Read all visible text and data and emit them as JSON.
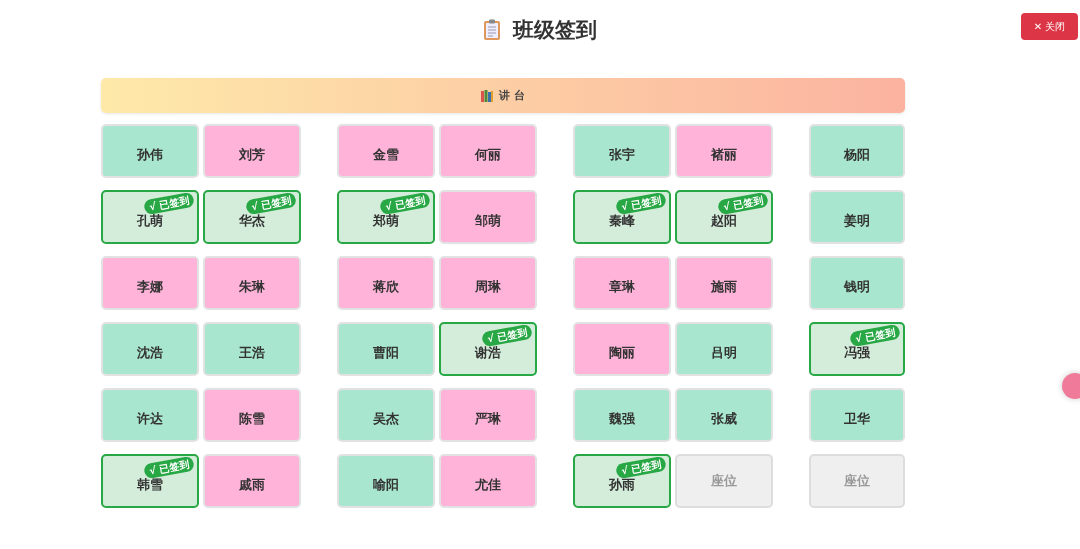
{
  "header": {
    "title": "班级签到",
    "close_button": "✕ 关闭"
  },
  "podium": {
    "label": "讲 台"
  },
  "rows": [
    {
      "seats": [
        {
          "kind": "student",
          "name": "孙伟",
          "color": "#a8e6cf",
          "signed": false
        },
        {
          "kind": "student",
          "name": "刘芳",
          "color": "#ffb3d9",
          "signed": false
        },
        {
          "kind": "student",
          "name": "金雪",
          "color": "#ffb3d9",
          "signed": false
        },
        {
          "kind": "student",
          "name": "何丽",
          "color": "#ffb3d9",
          "signed": false
        },
        {
          "kind": "student",
          "name": "张宇",
          "color": "#a8e6cf",
          "signed": false
        },
        {
          "kind": "student",
          "name": "褚丽",
          "color": "#ffb3d9",
          "signed": false
        },
        {
          "kind": "student",
          "name": "杨阳",
          "color": "#a8e6cf",
          "signed": false
        }
      ]
    },
    {
      "seats": [
        {
          "kind": "student",
          "name": "孔萌",
          "signed": true,
          "badge": "√ 已签到"
        },
        {
          "kind": "student",
          "name": "华杰",
          "signed": true,
          "badge": "√ 已签到"
        },
        {
          "kind": "student",
          "name": "郑萌",
          "signed": true,
          "badge": "√ 已签到"
        },
        {
          "kind": "student",
          "name": "邹萌",
          "color": "#ffb3d9",
          "signed": false
        },
        {
          "kind": "student",
          "name": "秦峰",
          "signed": true,
          "badge": "√ 已签到"
        },
        {
          "kind": "student",
          "name": "赵阳",
          "signed": true,
          "badge": "√ 已签到"
        },
        {
          "kind": "student",
          "name": "姜明",
          "color": "#a8e6cf",
          "signed": false
        }
      ]
    },
    {
      "seats": [
        {
          "kind": "student",
          "name": "李娜",
          "color": "#ffb3d9",
          "signed": false
        },
        {
          "kind": "student",
          "name": "朱琳",
          "color": "#ffb3d9",
          "signed": false
        },
        {
          "kind": "student",
          "name": "蒋欣",
          "color": "#ffb3d9",
          "signed": false
        },
        {
          "kind": "student",
          "name": "周琳",
          "color": "#ffb3d9",
          "signed": false
        },
        {
          "kind": "student",
          "name": "章琳",
          "color": "#ffb3d9",
          "signed": false
        },
        {
          "kind": "student",
          "name": "施雨",
          "color": "#ffb3d9",
          "signed": false
        },
        {
          "kind": "student",
          "name": "钱明",
          "color": "#a8e6cf",
          "signed": false
        }
      ]
    },
    {
      "seats": [
        {
          "kind": "student",
          "name": "沈浩",
          "color": "#a8e6cf",
          "signed": false
        },
        {
          "kind": "student",
          "name": "王浩",
          "color": "#a8e6cf",
          "signed": false
        },
        {
          "kind": "student",
          "name": "曹阳",
          "color": "#a8e6cf",
          "signed": false
        },
        {
          "kind": "student",
          "name": "谢浩",
          "signed": true,
          "badge": "√ 已签到"
        },
        {
          "kind": "student",
          "name": "陶丽",
          "color": "#ffb3d9",
          "signed": false
        },
        {
          "kind": "student",
          "name": "吕明",
          "color": "#a8e6cf",
          "signed": false
        },
        {
          "kind": "student",
          "name": "冯强",
          "signed": true,
          "badge": "√ 已签到"
        }
      ]
    },
    {
      "seats": [
        {
          "kind": "student",
          "name": "许达",
          "color": "#a8e6cf",
          "signed": false
        },
        {
          "kind": "student",
          "name": "陈雪",
          "color": "#ffb3d9",
          "signed": false
        },
        {
          "kind": "student",
          "name": "吴杰",
          "color": "#a8e6cf",
          "signed": false
        },
        {
          "kind": "student",
          "name": "严琳",
          "color": "#ffb3d9",
          "signed": false
        },
        {
          "kind": "student",
          "name": "魏强",
          "color": "#a8e6cf",
          "signed": false
        },
        {
          "kind": "student",
          "name": "张威",
          "color": "#a8e6cf",
          "signed": false
        },
        {
          "kind": "student",
          "name": "卫华",
          "color": "#a8e6cf",
          "signed": false
        }
      ]
    },
    {
      "seats": [
        {
          "kind": "student",
          "name": "韩雪",
          "signed": true,
          "badge": "√ 已签到"
        },
        {
          "kind": "student",
          "name": "戚雨",
          "color": "#ffb3d9",
          "signed": false
        },
        {
          "kind": "student",
          "name": "喻阳",
          "color": "#a8e6cf",
          "signed": false
        },
        {
          "kind": "student",
          "name": "尤佳",
          "color": "#ffb3d9",
          "signed": false
        },
        {
          "kind": "student",
          "name": "孙雨",
          "signed": true,
          "badge": "√ 已签到"
        },
        {
          "kind": "empty",
          "label": "座位"
        },
        {
          "kind": "empty",
          "label": "座位"
        }
      ]
    }
  ]
}
